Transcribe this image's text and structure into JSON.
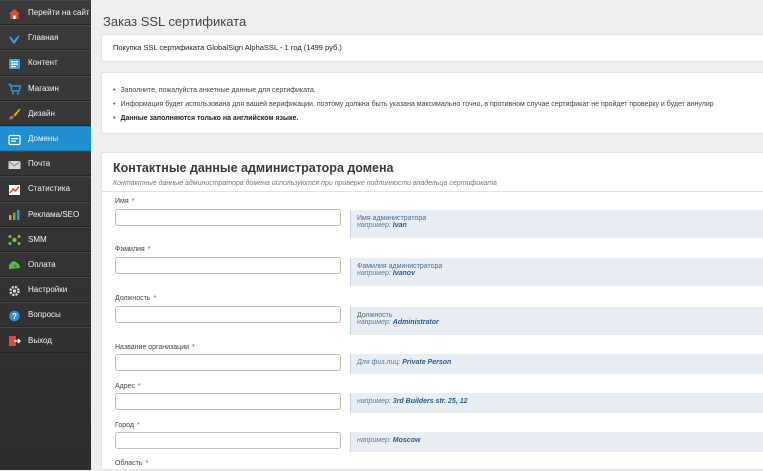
{
  "sidebar": {
    "items": [
      {
        "label": "Перейти на сайт",
        "icon": "home-icon",
        "color": "#e24b3b"
      },
      {
        "label": "Главная",
        "icon": "bird-icon",
        "color": "#3aa0e8"
      },
      {
        "label": "Контент",
        "icon": "content-icon",
        "color": "#2fa4e7"
      },
      {
        "label": "Магазин",
        "icon": "cart-icon",
        "color": "#2e9be0"
      },
      {
        "label": "Дизайн",
        "icon": "brush-icon",
        "color": "#e8b020"
      },
      {
        "label": "Домены",
        "icon": "domains-icon",
        "color": "#ffffff",
        "active": true
      },
      {
        "label": "Почта",
        "icon": "mail-icon",
        "color": "#d8d8d8"
      },
      {
        "label": "Статистика",
        "icon": "stats-icon",
        "color": "#d84a3a"
      },
      {
        "label": "Реклама/SEO",
        "icon": "seo-icon",
        "color": "#e8a020"
      },
      {
        "label": "SMM",
        "icon": "smm-icon",
        "color": "#7cc24c"
      },
      {
        "label": "Оплата",
        "icon": "payment-icon",
        "color": "#5bb846"
      },
      {
        "label": "Настройки",
        "icon": "gear-icon",
        "color": "#dddddd"
      },
      {
        "label": "Вопросы",
        "icon": "question-icon",
        "color": "#2d8fd6"
      },
      {
        "label": "Выход",
        "icon": "exit-icon",
        "color": "#e0493a"
      }
    ]
  },
  "page": {
    "title": "Заказ SSL сертификата",
    "purchase": "Покупка SSL сертификата GlobalSign AlphaSSL - 1 год (1499 руб.)",
    "notes": [
      "Заполните, пожалуйста анкетные данные для сертификата.",
      "Информация будет использована для вашей верификации, поэтому должна быть указана максимально точно, в противном случае сертификат не пройдет проверку и будет аннулир",
      "Данные заполняются только на английском языке."
    ]
  },
  "section": {
    "title": "Контактные данные администратора домена",
    "subtitle": "Контактные данные администратора домена используются при проверке подлинности владельца сертификата"
  },
  "fields": [
    {
      "label": "Имя",
      "required": "*",
      "value": "",
      "hint_label": "Имя администратора",
      "hint_prefix": "например:",
      "hint_example": "Ivan"
    },
    {
      "label": "Фамилия",
      "required": "*",
      "value": "",
      "hint_label": "Фамилия администратора",
      "hint_prefix": "например:",
      "hint_example": "Ivanov"
    },
    {
      "label": "Должность",
      "required": "*",
      "value": "",
      "hint_label": "Должность",
      "hint_prefix": "например:",
      "hint_example": "Administrator"
    },
    {
      "label": "Название организации",
      "required": "*",
      "value": "",
      "hint_label": "",
      "hint_prefix": "Для физ.лиц:",
      "hint_example": "Private Person"
    },
    {
      "label": "Адрес",
      "required": "*",
      "value": "",
      "hint_label": "",
      "hint_prefix": "например:",
      "hint_example": "3rd Builders str. 25, 12"
    },
    {
      "label": "Город",
      "required": "*",
      "value": "",
      "hint_label": "",
      "hint_prefix": "например:",
      "hint_example": "Moscow"
    },
    {
      "label": "Область",
      "required": "*",
      "value": "",
      "hint_label": "",
      "hint_prefix": "",
      "hint_example": ""
    }
  ]
}
